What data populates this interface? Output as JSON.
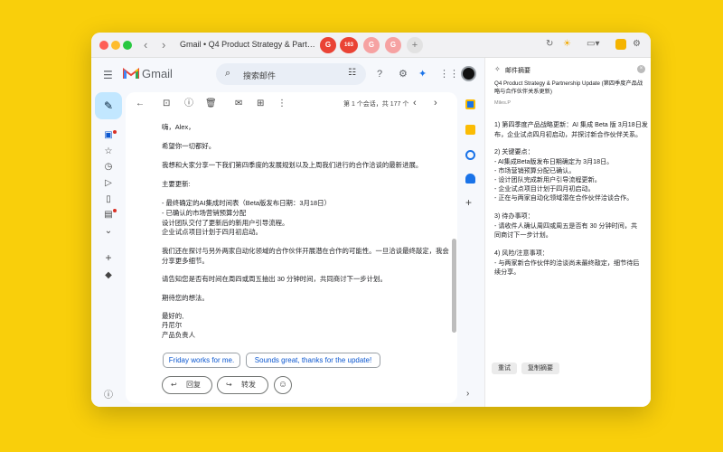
{
  "window": {
    "tab_title": "Gmail • Q4 Product Strategy & Partnership Update",
    "tab_chips": [
      "G",
      "163",
      "G",
      "G"
    ],
    "nav_back": "‹",
    "nav_forward": "›"
  },
  "gmail": {
    "logo_text": "Gmail",
    "search_placeholder": "搜索邮件"
  },
  "toolbar": {
    "pager": "第 1 个会话，共 177 个"
  },
  "email": {
    "lines": [
      "嗨，Alex，",
      "希望你一切都好。",
      "我想和大家分享一下我们第四季度的发展规划以及上周我们进行的合作洽谈的最新进展。",
      "主要更新:",
      "- 最终确定的AI集成时间表（Beta版发布日期：3月18日）",
      "- 已确认的市场营销预算分配",
      "设计团队交付了更新后的新用户引导流程。",
      "企业试点项目计划于四月初启动。",
      "我们还在探讨与另外两家自动化领域的合作伙伴开展潜在合作的可能性。一旦洽谈最终敲定，我会",
      "分享更多细节。",
      "请告知您是否有时间在周四或周五抽出 30 分钟时间，共同商讨下一步计划。",
      "期待您的想法。",
      "最好的,",
      "丹尼尔",
      "产品负责人"
    ],
    "smart_replies": [
      "Friday works for me.",
      "Sounds great, thanks for the update!"
    ],
    "reply_label": "回复",
    "forward_label": "转发"
  },
  "summary": {
    "panel_title": "邮件摘要",
    "subject": "Q4 Product Strategy & Partnership Update (第四季度产品战略与合作伙伴关系更新)",
    "sender": "Miles.P",
    "lines": [
      "1) 第四季度产品战略更新：AI 集成 Beta 版 3月18日发",
      "布，企业试点四月初启动，并探讨新合作伙伴关系。",
      "2) 关键要点：",
      "  - AI集成Beta版发布日期确定为 3月18日。",
      "  - 市场营销预算分配已确认。",
      "  - 设计团队完成新用户引导流程更新。",
      "  - 企业试点项目计划于四月初启动。",
      "  - 正在与两家自动化领域潜在合作伙伴洽谈合作。",
      "3) 待办事项：",
      "  - 请收件人确认周四或周五是否有 30 分钟时间，共",
      "  同商讨下一步计划。",
      "4) 风险/注意事项：",
      "  - 与两家新合作伙伴的洽谈尚未最终敲定，细节待后",
      "  续分享。"
    ],
    "reset_label": "重试",
    "copy_label": "复制摘要"
  },
  "colors": {
    "desktop": "#f9cf0b",
    "gmail_bg": "#f6f8fc",
    "compose": "#c2e7ff",
    "chip_text": "#0b57d0",
    "badge_red": "#ea4335"
  }
}
